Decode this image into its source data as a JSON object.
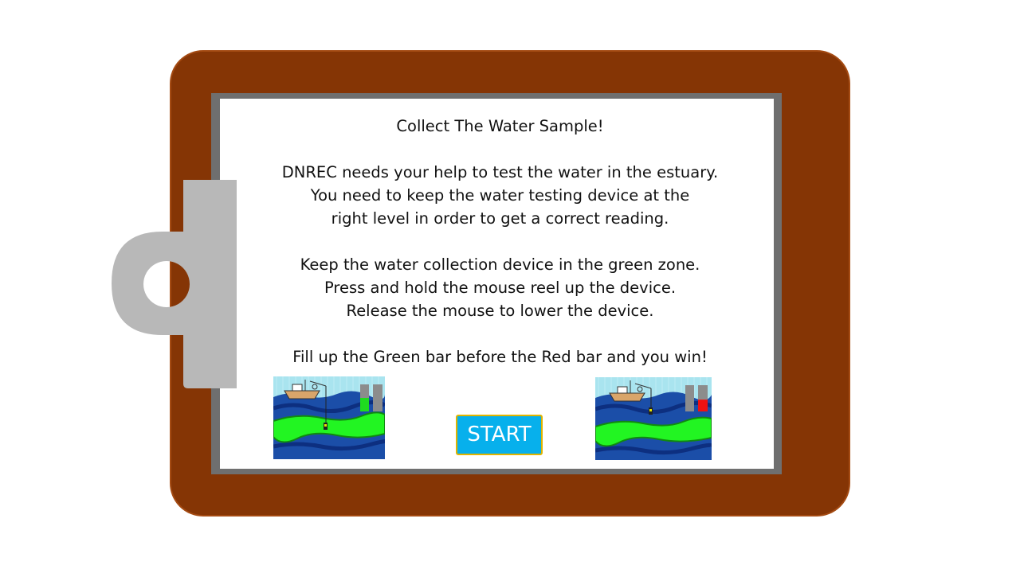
{
  "instructions": {
    "title": "Collect The Water Sample!",
    "intro": [
      "DNREC needs your help to test the water in the estuary.",
      "You need to keep the water testing device at the",
      "right level in order to get a correct reading."
    ],
    "controls": [
      "Keep the water collection device in the green zone.",
      "Press and hold the mouse reel up the device.",
      "Release the mouse to lower the device."
    ],
    "goal": "Fill up the Green bar before the Red bar and you win!"
  },
  "start_button": {
    "label": "START"
  },
  "examples": {
    "win": {
      "green_bar_level": 0.5,
      "red_bar_level": 0.0
    },
    "lose": {
      "green_bar_level": 0.0,
      "red_bar_level": 0.45
    }
  },
  "colors": {
    "board": "#853505",
    "frame": "#6f6f6f",
    "clip": "#b8b8b8",
    "sky": "#a9e4ef",
    "water": "#1b4ea8",
    "green_zone": "#22f522",
    "green_bar": "#1fdb1f",
    "red_bar": "#ee1111",
    "start_button": "#07b0ec"
  }
}
